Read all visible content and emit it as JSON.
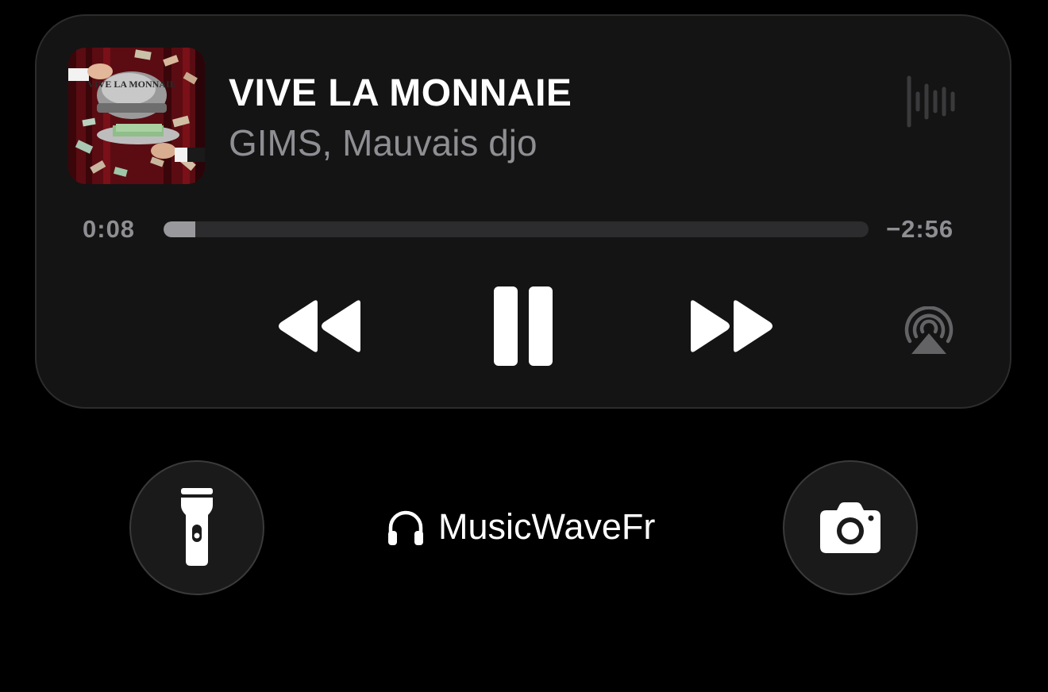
{
  "now_playing": {
    "title": "VIVE LA MONNAIE",
    "artist": "GIMS, Mauvais djo",
    "album_art_text": "VIVE LA MONNAIE",
    "elapsed": "0:08",
    "remaining": "−2:56",
    "progress_fraction": 0.045,
    "icons": {
      "waveform": "waveform-icon",
      "rewind": "backward-icon",
      "pause": "pause-icon",
      "forward": "forward-icon",
      "airplay": "airplay-icon"
    }
  },
  "bottom_bar": {
    "flashlight_icon": "flashlight-icon",
    "camera_icon": "camera-icon",
    "device_icon": "headphones-icon",
    "device_name": "MusicWaveFr"
  },
  "colors": {
    "background": "#000000",
    "card": "#141414",
    "secondary_text": "#8e8e93",
    "progress_track": "#2c2c2e",
    "progress_fill": "#98989d"
  }
}
